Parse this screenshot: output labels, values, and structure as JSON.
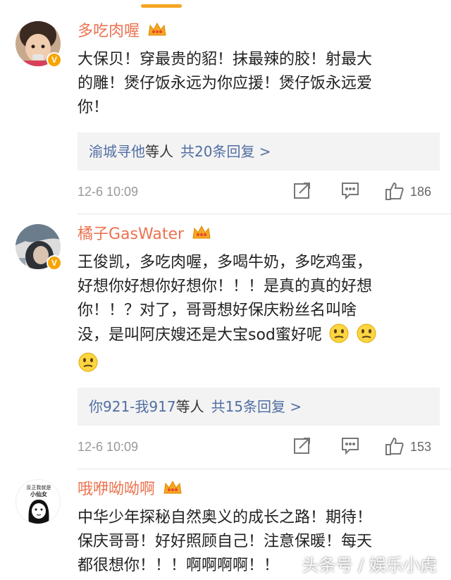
{
  "comments": [
    {
      "username": "多吃肉喔",
      "lines": [
        "大保贝！穿最贵的貂！抹最辣的胶！射最大",
        "的雕！煲仔饭永远为你应援！煲仔饭永远爱",
        "你！"
      ],
      "reply_names": "渝城寻他",
      "reply_text": "等人",
      "reply_count": "共20条回复 >",
      "timestamp": "12-6 10:09",
      "likes": "186"
    },
    {
      "username": "橘子GasWater",
      "lines": [
        "王俊凯，多吃肉喔，多喝牛奶，多吃鸡蛋，",
        "好想你好想你好想你！！！是真的真的好想",
        "你！！？对了，哥哥想好保庆粉丝名叫啥",
        "没，是叫阿庆嫂还是大宝sod蜜好呢"
      ],
      "reply_names": "你921-我917",
      "reply_text": "等人",
      "reply_count": "共15条回复 >",
      "timestamp": "12-6 10:09",
      "likes": "153"
    },
    {
      "username": "哦咿呦呦啊",
      "avatar_text_top": "反正我就是",
      "avatar_text_bottom": "小仙女",
      "lines": [
        "中华少年探秘自然奥义的成长之路！期待！",
        "保庆哥哥！好好照顾自己！注意保暖！每天",
        "都很想你！！！啊啊啊啊！！"
      ]
    }
  ],
  "watermark": "头条号 / 娱乐小虎",
  "colors": {
    "username": "#eb7350",
    "link": "#516ea3",
    "badge": "#f7a400"
  },
  "icons": [
    "crown-icon",
    "verified-badge-icon",
    "share-icon",
    "comment-icon",
    "thumbs-up-icon",
    "thinking-emoji-icon"
  ]
}
